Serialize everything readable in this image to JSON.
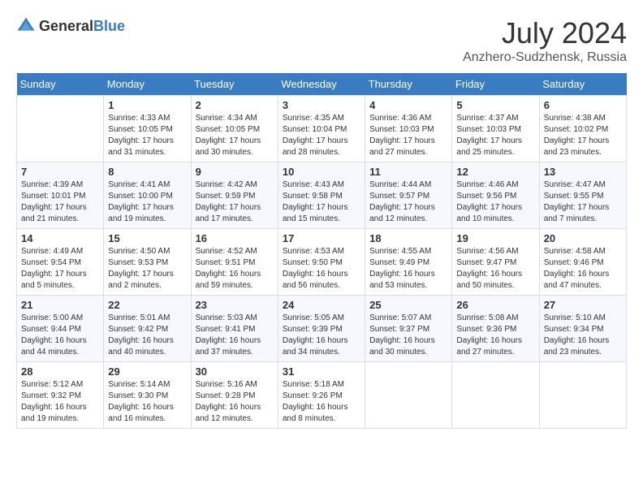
{
  "header": {
    "logo_general": "General",
    "logo_blue": "Blue",
    "title": "July 2024",
    "location": "Anzhero-Sudzhensk, Russia"
  },
  "calendar": {
    "days_of_week": [
      "Sunday",
      "Monday",
      "Tuesday",
      "Wednesday",
      "Thursday",
      "Friday",
      "Saturday"
    ],
    "weeks": [
      [
        {
          "day": "",
          "info": ""
        },
        {
          "day": "1",
          "info": "Sunrise: 4:33 AM\nSunset: 10:05 PM\nDaylight: 17 hours\nand 31 minutes."
        },
        {
          "day": "2",
          "info": "Sunrise: 4:34 AM\nSunset: 10:05 PM\nDaylight: 17 hours\nand 30 minutes."
        },
        {
          "day": "3",
          "info": "Sunrise: 4:35 AM\nSunset: 10:04 PM\nDaylight: 17 hours\nand 28 minutes."
        },
        {
          "day": "4",
          "info": "Sunrise: 4:36 AM\nSunset: 10:03 PM\nDaylight: 17 hours\nand 27 minutes."
        },
        {
          "day": "5",
          "info": "Sunrise: 4:37 AM\nSunset: 10:03 PM\nDaylight: 17 hours\nand 25 minutes."
        },
        {
          "day": "6",
          "info": "Sunrise: 4:38 AM\nSunset: 10:02 PM\nDaylight: 17 hours\nand 23 minutes."
        }
      ],
      [
        {
          "day": "7",
          "info": "Sunrise: 4:39 AM\nSunset: 10:01 PM\nDaylight: 17 hours\nand 21 minutes."
        },
        {
          "day": "8",
          "info": "Sunrise: 4:41 AM\nSunset: 10:00 PM\nDaylight: 17 hours\nand 19 minutes."
        },
        {
          "day": "9",
          "info": "Sunrise: 4:42 AM\nSunset: 9:59 PM\nDaylight: 17 hours\nand 17 minutes."
        },
        {
          "day": "10",
          "info": "Sunrise: 4:43 AM\nSunset: 9:58 PM\nDaylight: 17 hours\nand 15 minutes."
        },
        {
          "day": "11",
          "info": "Sunrise: 4:44 AM\nSunset: 9:57 PM\nDaylight: 17 hours\nand 12 minutes."
        },
        {
          "day": "12",
          "info": "Sunrise: 4:46 AM\nSunset: 9:56 PM\nDaylight: 17 hours\nand 10 minutes."
        },
        {
          "day": "13",
          "info": "Sunrise: 4:47 AM\nSunset: 9:55 PM\nDaylight: 17 hours\nand 7 minutes."
        }
      ],
      [
        {
          "day": "14",
          "info": "Sunrise: 4:49 AM\nSunset: 9:54 PM\nDaylight: 17 hours\nand 5 minutes."
        },
        {
          "day": "15",
          "info": "Sunrise: 4:50 AM\nSunset: 9:53 PM\nDaylight: 17 hours\nand 2 minutes."
        },
        {
          "day": "16",
          "info": "Sunrise: 4:52 AM\nSunset: 9:51 PM\nDaylight: 16 hours\nand 59 minutes."
        },
        {
          "day": "17",
          "info": "Sunrise: 4:53 AM\nSunset: 9:50 PM\nDaylight: 16 hours\nand 56 minutes."
        },
        {
          "day": "18",
          "info": "Sunrise: 4:55 AM\nSunset: 9:49 PM\nDaylight: 16 hours\nand 53 minutes."
        },
        {
          "day": "19",
          "info": "Sunrise: 4:56 AM\nSunset: 9:47 PM\nDaylight: 16 hours\nand 50 minutes."
        },
        {
          "day": "20",
          "info": "Sunrise: 4:58 AM\nSunset: 9:46 PM\nDaylight: 16 hours\nand 47 minutes."
        }
      ],
      [
        {
          "day": "21",
          "info": "Sunrise: 5:00 AM\nSunset: 9:44 PM\nDaylight: 16 hours\nand 44 minutes."
        },
        {
          "day": "22",
          "info": "Sunrise: 5:01 AM\nSunset: 9:42 PM\nDaylight: 16 hours\nand 40 minutes."
        },
        {
          "day": "23",
          "info": "Sunrise: 5:03 AM\nSunset: 9:41 PM\nDaylight: 16 hours\nand 37 minutes."
        },
        {
          "day": "24",
          "info": "Sunrise: 5:05 AM\nSunset: 9:39 PM\nDaylight: 16 hours\nand 34 minutes."
        },
        {
          "day": "25",
          "info": "Sunrise: 5:07 AM\nSunset: 9:37 PM\nDaylight: 16 hours\nand 30 minutes."
        },
        {
          "day": "26",
          "info": "Sunrise: 5:08 AM\nSunset: 9:36 PM\nDaylight: 16 hours\nand 27 minutes."
        },
        {
          "day": "27",
          "info": "Sunrise: 5:10 AM\nSunset: 9:34 PM\nDaylight: 16 hours\nand 23 minutes."
        }
      ],
      [
        {
          "day": "28",
          "info": "Sunrise: 5:12 AM\nSunset: 9:32 PM\nDaylight: 16 hours\nand 19 minutes."
        },
        {
          "day": "29",
          "info": "Sunrise: 5:14 AM\nSunset: 9:30 PM\nDaylight: 16 hours\nand 16 minutes."
        },
        {
          "day": "30",
          "info": "Sunrise: 5:16 AM\nSunset: 9:28 PM\nDaylight: 16 hours\nand 12 minutes."
        },
        {
          "day": "31",
          "info": "Sunrise: 5:18 AM\nSunset: 9:26 PM\nDaylight: 16 hours\nand 8 minutes."
        },
        {
          "day": "",
          "info": ""
        },
        {
          "day": "",
          "info": ""
        },
        {
          "day": "",
          "info": ""
        }
      ]
    ]
  }
}
